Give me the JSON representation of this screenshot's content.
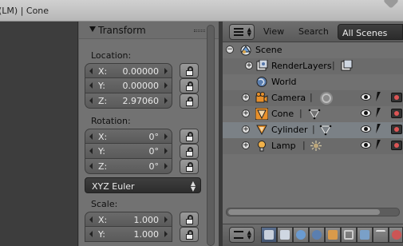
{
  "window": {
    "title": "(LM) | Cone"
  },
  "properties": {
    "panel_title": "Transform",
    "location": {
      "label": "Location:",
      "fields": [
        {
          "axis": "X:",
          "value": "0.00000"
        },
        {
          "axis": "Y:",
          "value": "0.00000"
        },
        {
          "axis": "Z:",
          "value": "2.97060"
        }
      ]
    },
    "rotation": {
      "label": "Rotation:",
      "fields": [
        {
          "axis": "X:",
          "value": "0°"
        },
        {
          "axis": "Y:",
          "value": "0°"
        },
        {
          "axis": "Z:",
          "value": "0°"
        }
      ],
      "mode": "XYZ Euler"
    },
    "scale": {
      "label": "Scale:",
      "fields": [
        {
          "axis": "X:",
          "value": "1.000"
        },
        {
          "axis": "Y:",
          "value": "1.000"
        }
      ]
    }
  },
  "outliner": {
    "menus": {
      "view": "View",
      "search": "Search"
    },
    "display_mode": "All Scenes",
    "tree": [
      {
        "name": "Scene",
        "icon": "scene-icon"
      },
      {
        "name": "RenderLayers",
        "icon": "render-layers-icon"
      },
      {
        "name": "World",
        "icon": "world-icon"
      },
      {
        "name": "Camera",
        "icon": "camera-object-icon"
      },
      {
        "name": "Cone",
        "icon": "cone-mesh-icon"
      },
      {
        "name": "Cylinder",
        "icon": "cylinder-mesh-icon"
      },
      {
        "name": "Lamp",
        "icon": "lamp-icon"
      }
    ]
  },
  "colors": {
    "selected_row": "#7b8186",
    "accent_orange": "#e8902a",
    "active_tab": "#4b5f7e"
  }
}
